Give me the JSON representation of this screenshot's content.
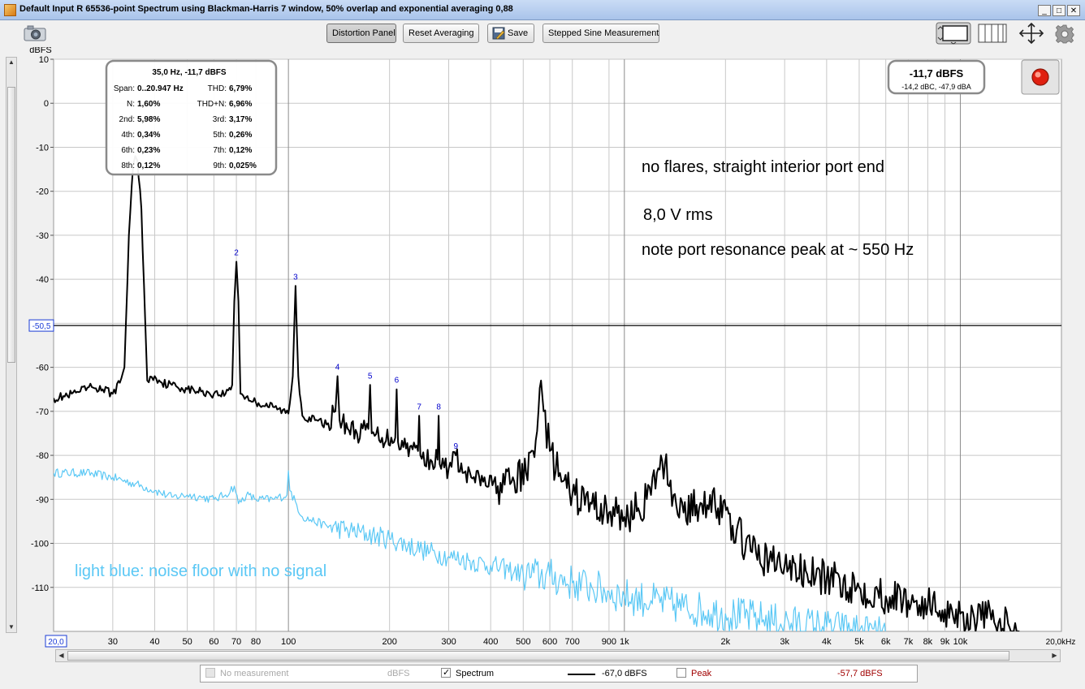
{
  "window": {
    "title": "Default Input R 65536-point Spectrum using Blackman-Harris 7 window, 50% overlap and exponential averaging 0,88",
    "minimize": "_",
    "maximize": "□",
    "close": "✕"
  },
  "toolbar": {
    "distortion_panel": "Distortion Panel",
    "reset_averaging": "Reset Averaging",
    "save": "Save",
    "stepped_sine": "Stepped Sine Measurement",
    "icons": [
      "camera-icon",
      "screen-layout-icon",
      "grid-columns-icon",
      "expand-arrows-icon",
      "gear-icon"
    ]
  },
  "distortion_panel": {
    "header": "35,0 Hz, -11,7 dBFS",
    "rows": [
      {
        "l1": "Span:",
        "v1": "0..20.947 Hz",
        "l2": "THD:",
        "v2": "6,79%"
      },
      {
        "l1": "N:",
        "v1": "1,60%",
        "l2": "THD+N:",
        "v2": "6,96%"
      },
      {
        "l1": "2nd:",
        "v1": "5,98%",
        "l2": "3rd:",
        "v2": "3,17%"
      },
      {
        "l1": "4th:",
        "v1": "0,34%",
        "l2": "5th:",
        "v2": "0,26%"
      },
      {
        "l1": "6th:",
        "v1": "0,23%",
        "l2": "7th:",
        "v2": "0,12%"
      },
      {
        "l1": "8th:",
        "v1": "0,12%",
        "l2": "9th:",
        "v2": "0,025%"
      }
    ]
  },
  "level_meter": {
    "main": "-11,7 dBFS",
    "sub": "-14,2 dBC, -47,9 dBA"
  },
  "annotations": {
    "line1": "no flares, straight interior port end",
    "line2": "8,0 V rms",
    "line3": "note port resonance peak at ~ 550 Hz",
    "noise_note": "light blue: noise floor with no signal"
  },
  "legend": {
    "no_measurement": "No measurement",
    "dbfs": "dBFS",
    "spectrum": "Spectrum",
    "spectrum_value": "-67,0 dBFS",
    "peak": "Peak",
    "peak_value": "-57,7 dBFS"
  },
  "colors": {
    "spectrum": "#000000",
    "noise": "#5bc8f5",
    "harmonic_label": "#0000cc",
    "peak": "#a00000",
    "grid": "#c8c8c8",
    "level_led": "#e02010"
  },
  "chart_data": {
    "type": "line",
    "ylabel": "dBFS",
    "xscale": "log",
    "xlim": [
      20,
      20000
    ],
    "ylim": [
      -120,
      10
    ],
    "y_ticks": [
      10,
      0,
      -10,
      -20,
      -30,
      -40,
      -50,
      -60,
      -70,
      -80,
      -90,
      -100,
      -110
    ],
    "y_tick_labels": [
      "10",
      "0",
      "-10",
      "-20",
      "-30",
      "-40",
      "",
      "-60",
      "-70",
      "-80",
      "-90",
      "-100",
      "-110"
    ],
    "x_ticks": [
      30,
      40,
      50,
      60,
      70,
      80,
      100,
      200,
      300,
      400,
      500,
      600,
      700,
      900,
      1000,
      2000,
      3000,
      4000,
      5000,
      6000,
      7000,
      8000,
      9000,
      10000
    ],
    "x_tick_labels": [
      "30",
      "40",
      "50",
      "60",
      "70",
      "80",
      "100",
      "200",
      "300",
      "400",
      "500",
      "600",
      "700",
      "900",
      "1k",
      "2k",
      "3k",
      "4k",
      "5k",
      "6k",
      "7k",
      "8k",
      "9k",
      "10k"
    ],
    "x_start_label": "20,0",
    "x_end_label": "20,0kHz",
    "marker_line": {
      "y": -50.5,
      "label": "-50,5"
    },
    "harmonics": [
      {
        "n": "2",
        "freq": 70,
        "level": -36
      },
      {
        "n": "3",
        "freq": 105,
        "level": -41.5
      },
      {
        "n": "4",
        "freq": 140,
        "level": -62
      },
      {
        "n": "5",
        "freq": 175,
        "level": -64
      },
      {
        "n": "6",
        "freq": 210,
        "level": -65
      },
      {
        "n": "7",
        "freq": 245,
        "level": -71
      },
      {
        "n": "8",
        "freq": 280,
        "level": -71
      },
      {
        "n": "9",
        "freq": 315,
        "level": -80
      }
    ],
    "series": [
      {
        "name": "Spectrum",
        "color": "#000000",
        "points": [
          [
            20,
            -67
          ],
          [
            22,
            -66.5
          ],
          [
            24,
            -65.5
          ],
          [
            26,
            -64.5
          ],
          [
            28,
            -65
          ],
          [
            30,
            -66
          ],
          [
            31.5,
            -63.5
          ],
          [
            32.5,
            -60
          ],
          [
            33.5,
            -30
          ],
          [
            34.5,
            -14
          ],
          [
            35,
            -12
          ],
          [
            35.5,
            -13
          ],
          [
            36.5,
            -24
          ],
          [
            37.5,
            -50
          ],
          [
            38,
            -63
          ],
          [
            40,
            -62
          ],
          [
            42,
            -63.5
          ],
          [
            45,
            -64
          ],
          [
            50,
            -65
          ],
          [
            55,
            -65.5
          ],
          [
            60,
            -66
          ],
          [
            65,
            -66
          ],
          [
            68,
            -64
          ],
          [
            69,
            -45
          ],
          [
            70,
            -36
          ],
          [
            71,
            -45
          ],
          [
            72,
            -66
          ],
          [
            80,
            -68
          ],
          [
            90,
            -69
          ],
          [
            100,
            -70.5
          ],
          [
            103,
            -62
          ],
          [
            105,
            -41.5
          ],
          [
            107,
            -62
          ],
          [
            110,
            -71
          ],
          [
            120,
            -72
          ],
          [
            130,
            -73
          ],
          [
            138,
            -70
          ],
          [
            140,
            -62
          ],
          [
            142,
            -72
          ],
          [
            160,
            -75
          ],
          [
            173,
            -74
          ],
          [
            175,
            -64
          ],
          [
            177,
            -75
          ],
          [
            190,
            -76
          ],
          [
            208,
            -76
          ],
          [
            210,
            -65
          ],
          [
            212,
            -77
          ],
          [
            230,
            -78
          ],
          [
            243,
            -79
          ],
          [
            245,
            -71
          ],
          [
            247,
            -80
          ],
          [
            265,
            -81
          ],
          [
            278,
            -81
          ],
          [
            280,
            -71
          ],
          [
            282,
            -82
          ],
          [
            300,
            -83
          ],
          [
            315,
            -80
          ],
          [
            330,
            -84
          ],
          [
            350,
            -85
          ],
          [
            380,
            -86
          ],
          [
            420,
            -87
          ],
          [
            470,
            -86
          ],
          [
            510,
            -84
          ],
          [
            535,
            -79
          ],
          [
            555,
            -70
          ],
          [
            565,
            -63
          ],
          [
            575,
            -70
          ],
          [
            600,
            -79
          ],
          [
            650,
            -86
          ],
          [
            700,
            -89
          ],
          [
            800,
            -91
          ],
          [
            900,
            -93
          ],
          [
            1000,
            -94
          ],
          [
            1100,
            -92
          ],
          [
            1200,
            -89
          ],
          [
            1250,
            -84
          ],
          [
            1320,
            -82
          ],
          [
            1400,
            -89
          ],
          [
            1500,
            -93
          ],
          [
            1700,
            -91
          ],
          [
            1800,
            -89
          ],
          [
            1900,
            -92
          ],
          [
            2100,
            -96
          ],
          [
            2400,
            -102
          ],
          [
            2700,
            -104
          ],
          [
            3000,
            -105
          ],
          [
            3500,
            -107
          ],
          [
            4000,
            -108
          ],
          [
            5000,
            -110
          ],
          [
            6000,
            -112
          ],
          [
            7000,
            -113
          ],
          [
            8000,
            -114
          ],
          [
            9000,
            -115
          ],
          [
            10000,
            -116
          ],
          [
            11000,
            -117
          ],
          [
            12000,
            -117
          ],
          [
            13000,
            -118
          ],
          [
            14000,
            -119
          ],
          [
            15000,
            -120
          ]
        ]
      },
      {
        "name": "noise floor",
        "color": "#5bc8f5",
        "points": [
          [
            20,
            -84
          ],
          [
            25,
            -84
          ],
          [
            30,
            -85
          ],
          [
            35,
            -86.5
          ],
          [
            40,
            -88
          ],
          [
            45,
            -89.5
          ],
          [
            50,
            -89
          ],
          [
            55,
            -89.5
          ],
          [
            60,
            -90
          ],
          [
            65,
            -89
          ],
          [
            69,
            -87
          ],
          [
            71,
            -91
          ],
          [
            75,
            -89
          ],
          [
            80,
            -90
          ],
          [
            90,
            -90
          ],
          [
            99,
            -89
          ],
          [
            100,
            -83.5
          ],
          [
            101,
            -88
          ],
          [
            110,
            -94
          ],
          [
            130,
            -96
          ],
          [
            150,
            -97
          ],
          [
            200,
            -99
          ],
          [
            250,
            -101.5
          ],
          [
            300,
            -103
          ],
          [
            400,
            -105
          ],
          [
            500,
            -107
          ],
          [
            600,
            -107.5
          ],
          [
            700,
            -109
          ],
          [
            800,
            -110
          ],
          [
            900,
            -111
          ],
          [
            1000,
            -112
          ],
          [
            1200,
            -113
          ],
          [
            1500,
            -114.5
          ],
          [
            2000,
            -116
          ],
          [
            2500,
            -117
          ],
          [
            3000,
            -118
          ],
          [
            4000,
            -119
          ],
          [
            5000,
            -120
          ],
          [
            6000,
            -121
          ]
        ]
      }
    ]
  }
}
